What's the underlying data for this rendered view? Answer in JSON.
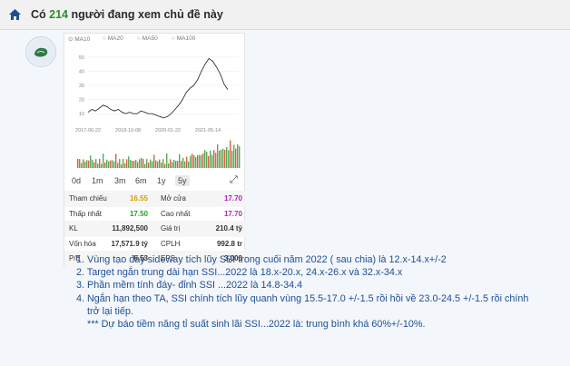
{
  "header": {
    "prefix": "Có",
    "count": "214",
    "suffix": "người đang xem chủ đề này"
  },
  "legend": [
    "MA10",
    "MA20",
    "MA50",
    "MA100"
  ],
  "chart_data": {
    "type": "line",
    "x_ticks": [
      "2017-06-22",
      "2018-10-08",
      "2020-01-22",
      "2021-05-14"
    ],
    "y_ticks": [
      10,
      20,
      30,
      40,
      50
    ],
    "ylim": [
      5,
      55
    ],
    "series": [
      {
        "values": [
          11,
          13,
          12,
          14,
          16,
          15,
          13,
          12,
          13,
          11,
          10,
          11,
          10,
          10,
          12,
          11,
          10,
          10,
          9,
          8,
          7,
          8,
          10,
          13,
          16,
          20,
          25,
          28,
          30,
          34,
          40,
          45,
          49,
          47,
          43,
          38,
          31,
          27
        ]
      }
    ]
  },
  "timeframes": [
    "0d",
    "1m",
    "3m",
    "6m",
    "1y",
    "5y"
  ],
  "active_timeframe": "5y",
  "stats": [
    {
      "l1": "Tham chiếu",
      "v1": "16.55",
      "c1": "yellow",
      "l2": "Mở cửa",
      "v2": "17.70",
      "c2": "purple"
    },
    {
      "l1": "Thấp nhất",
      "v1": "17.50",
      "c1": "green",
      "l2": "Cao nhất",
      "v2": "17.70",
      "c2": "purple"
    },
    {
      "l1": "KL",
      "v1": "11,892,500",
      "c1": "",
      "l2": "Giá trị",
      "v2": "210.4 tỷ",
      "c2": ""
    },
    {
      "l1": "Vốn hóa",
      "v1": "17,571.9 tỷ",
      "c1": "",
      "l2": "CPLH",
      "v2": "992.8 tr",
      "c2": ""
    },
    {
      "l1": "P/E",
      "v1": "6.53",
      "c1": "",
      "l2": "EPS",
      "v2": "3,000",
      "c2": ""
    }
  ],
  "content": {
    "items": [
      "1. Vùng tạo đáy sideway tích lũy SSI trong cuối năm 2022 ( sau chia) là 12.x-14.x+/-2",
      "2. Target ngắn trung dài hạn SSI...2022 là 18.x-20.x, 24.x-26.x và 32.x-34.x",
      "3. Phần mềm tính đáy- đỉnh SSI ...2022 là 14.8-34.4",
      "4. Ngắn hạn theo TA, SSI chính tích lũy quanh vùng 15.5-17.0 +/-1.5 rồi hồi về 23.0-24.5 +/-1.5 rồi chính"
    ],
    "continuation": "trở lại tiếp.",
    "note": "*** Dự báo tiềm năng tỉ suất sinh lãi SSI...2022 là: trung bình khá 60%+/-10%."
  }
}
